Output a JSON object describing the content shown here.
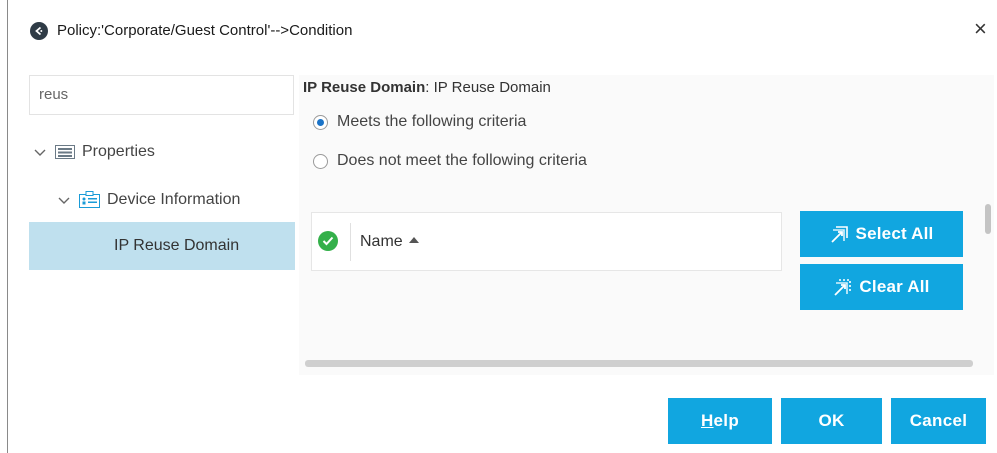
{
  "window": {
    "title": "Policy:'Corporate/Guest Control'-->Condition",
    "close_glyph": "×"
  },
  "left_panel": {
    "search": {
      "value": "reus"
    },
    "tree": {
      "root": {
        "label": "Properties",
        "icon": "list-icon"
      },
      "child": {
        "label": "Device Information",
        "icon": "device-info-icon"
      },
      "leaf": {
        "label": "IP Reuse Domain",
        "selected": true
      }
    }
  },
  "condition": {
    "title_bold": "IP Reuse Domain",
    "title_rest": ": IP Reuse Domain",
    "options": [
      {
        "label": "Meets the following criteria",
        "checked": true
      },
      {
        "label": "Does not meet the following criteria",
        "checked": false
      }
    ],
    "grid": {
      "column": "Name"
    },
    "buttons": {
      "select_all": "Select All",
      "clear_all": "Clear All"
    }
  },
  "footer": {
    "help_first": "H",
    "help_rest": "elp",
    "ok": "OK",
    "cancel": "Cancel"
  },
  "colors": {
    "accent": "#11a6e0",
    "selection": "#bfe0ee",
    "check_green": "#34b04a",
    "radio_blue": "#1a73c7"
  }
}
